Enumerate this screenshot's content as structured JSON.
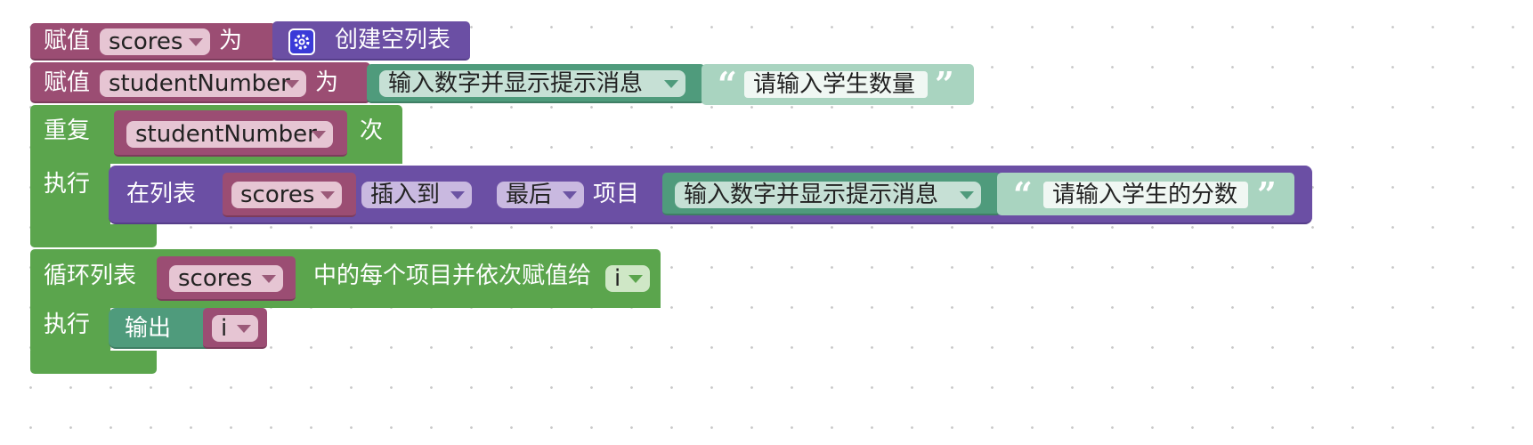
{
  "colors": {
    "variable": "#9b4d73",
    "variable_dark": "#7c3c5c",
    "list": "#6b4fa4",
    "list_dark": "#563e8a",
    "loop": "#5ba54d",
    "math": "#4f9b7c",
    "math_dark": "#3f7f65",
    "text_block": "#a9d4c0"
  },
  "block1": {
    "set": "赋值",
    "var": "scores",
    "to": "为",
    "gear_icon": "gear-icon",
    "create_empty_list": "创建空列表"
  },
  "block2": {
    "set": "赋值",
    "var": "studentNumber",
    "to": "为",
    "prompt_type": "输入数字并显示提示消息",
    "prompt_text": "请输入学生数量"
  },
  "block3": {
    "repeat": "重复",
    "times_var": "studentNumber",
    "times": "次",
    "do": "执行"
  },
  "block3_inner": {
    "in_list": "在列表",
    "list_var": "scores",
    "mode": "插入到",
    "where": "最后",
    "item": "项目",
    "prompt_type": "输入数字并显示提示消息",
    "prompt_text": "请输入学生的分数"
  },
  "block4": {
    "for_each": "循环列表",
    "list_var": "scores",
    "assign_text": "中的每个项目并依次赋值给",
    "item_var": "i",
    "do": "执行"
  },
  "block4_inner": {
    "print": "输出",
    "var": "i"
  }
}
